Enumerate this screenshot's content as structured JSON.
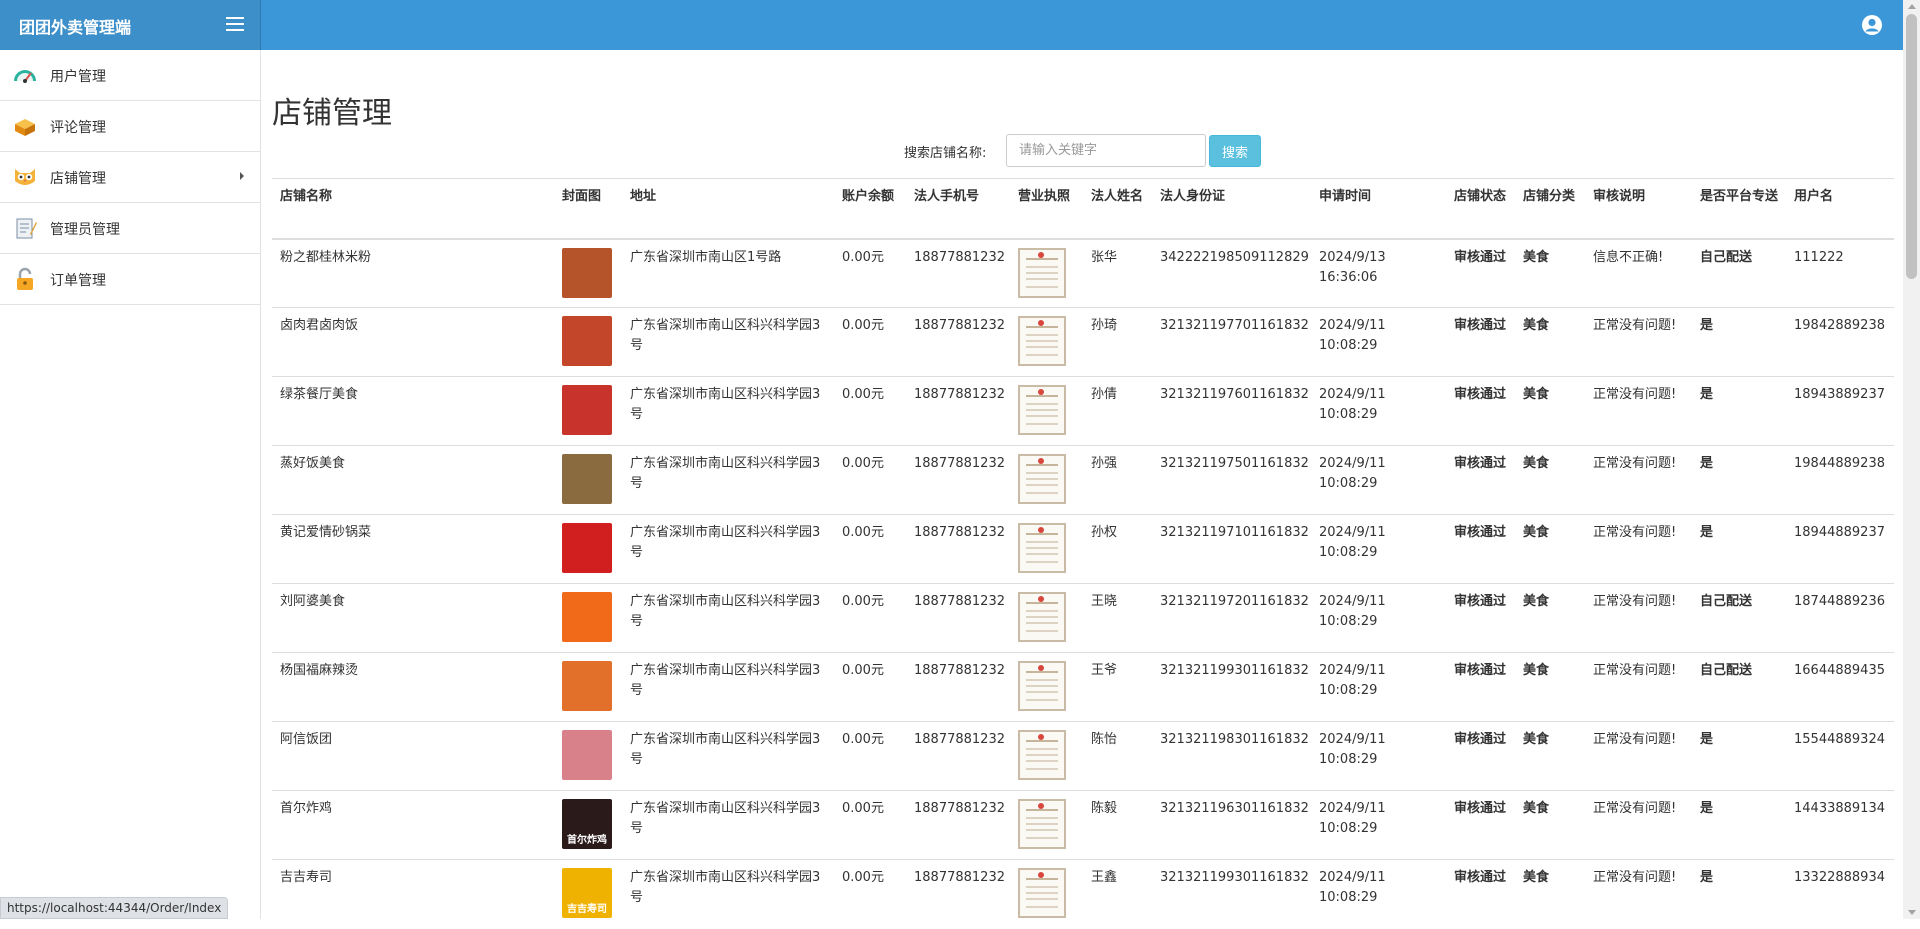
{
  "app": {
    "title": "团团外卖管理端"
  },
  "sidebar": {
    "items": [
      {
        "label": "用户管理",
        "icon": "dashboard-icon",
        "color": "#2bb3a0"
      },
      {
        "label": "评论管理",
        "icon": "bricks-icon",
        "color": "#f0a21b"
      },
      {
        "label": "店铺管理",
        "icon": "owl-icon",
        "color": "#f4b23a",
        "has_submenu": true
      },
      {
        "label": "管理员管理",
        "icon": "notepad-icon",
        "color": "#7a8fa6"
      },
      {
        "label": "订单管理",
        "icon": "padlock-icon",
        "color": "#f5a623"
      }
    ]
  },
  "page": {
    "title": "店铺管理"
  },
  "search": {
    "label": "搜索店铺名称:",
    "placeholder": "请输入关键字",
    "button": "搜索"
  },
  "table": {
    "headers": [
      "店铺名称",
      "封面图",
      "地址",
      "账户余额",
      "法人手机号",
      "营业执照",
      "法人姓名",
      "法人身份证",
      "申请时间",
      "店铺状态",
      "店铺分类",
      "审核说明",
      "是否平台专送",
      "用户名"
    ],
    "rows": [
      {
        "name": "粉之都桂林米粉",
        "cover_color": "#b5542b",
        "cover_text": "",
        "address": "广东省深圳市南山区1号路",
        "balance": "0.00元",
        "phone": "18877881232",
        "legal_name": "张华",
        "id_card": "342222198509112829",
        "apply_time": "2024/9/13 16:36:06",
        "status": "审核通过",
        "category": "美食",
        "note": "信息不正确!",
        "platform_delivery": "自己配送",
        "username": "111222"
      },
      {
        "name": "卤肉君卤肉饭",
        "cover_color": "#c4462a",
        "cover_text": "",
        "address": "广东省深圳市南山区科兴科学园3号",
        "balance": "0.00元",
        "phone": "18877881232",
        "legal_name": "孙琦",
        "id_card": "321321197701161832",
        "apply_time": "2024/9/11 10:08:29",
        "status": "审核通过",
        "category": "美食",
        "note": "正常没有问题!",
        "platform_delivery": "是",
        "username": "19842889238"
      },
      {
        "name": "绿茶餐厅美食",
        "cover_color": "#c8342c",
        "cover_text": "",
        "address": "广东省深圳市南山区科兴科学园3号",
        "balance": "0.00元",
        "phone": "18877881232",
        "legal_name": "孙倩",
        "id_card": "321321197601161832",
        "apply_time": "2024/9/11 10:08:29",
        "status": "审核通过",
        "category": "美食",
        "note": "正常没有问题!",
        "platform_delivery": "是",
        "username": "18943889237"
      },
      {
        "name": "蒸好饭美食",
        "cover_color": "#8a6a3f",
        "cover_text": "",
        "address": "广东省深圳市南山区科兴科学园3号",
        "balance": "0.00元",
        "phone": "18877881232",
        "legal_name": "孙强",
        "id_card": "321321197501161832",
        "apply_time": "2024/9/11 10:08:29",
        "status": "审核通过",
        "category": "美食",
        "note": "正常没有问题!",
        "platform_delivery": "是",
        "username": "19844889238"
      },
      {
        "name": "黄记爱情砂锅菜",
        "cover_color": "#d11f1f",
        "cover_text": "",
        "address": "广东省深圳市南山区科兴科学园3号",
        "balance": "0.00元",
        "phone": "18877881232",
        "legal_name": "孙权",
        "id_card": "321321197101161832",
        "apply_time": "2024/9/11 10:08:29",
        "status": "审核通过",
        "category": "美食",
        "note": "正常没有问题!",
        "platform_delivery": "是",
        "username": "18944889237"
      },
      {
        "name": "刘阿婆美食",
        "cover_color": "#f06a1a",
        "cover_text": "",
        "address": "广东省深圳市南山区科兴科学园3号",
        "balance": "0.00元",
        "phone": "18877881232",
        "legal_name": "王晓",
        "id_card": "321321197201161832",
        "apply_time": "2024/9/11 10:08:29",
        "status": "审核通过",
        "category": "美食",
        "note": "正常没有问题!",
        "platform_delivery": "自己配送",
        "username": "18744889236"
      },
      {
        "name": "杨国福麻辣烫",
        "cover_color": "#e2702a",
        "cover_text": "",
        "address": "广东省深圳市南山区科兴科学园3号",
        "balance": "0.00元",
        "phone": "18877881232",
        "legal_name": "王爷",
        "id_card": "321321199301161832",
        "apply_time": "2024/9/11 10:08:29",
        "status": "审核通过",
        "category": "美食",
        "note": "正常没有问题!",
        "platform_delivery": "自己配送",
        "username": "16644889435"
      },
      {
        "name": "阿信饭团",
        "cover_color": "#d9818a",
        "cover_text": "",
        "address": "广东省深圳市南山区科兴科学园3号",
        "balance": "0.00元",
        "phone": "18877881232",
        "legal_name": "陈怡",
        "id_card": "321321198301161832",
        "apply_time": "2024/9/11 10:08:29",
        "status": "审核通过",
        "category": "美食",
        "note": "正常没有问题!",
        "platform_delivery": "是",
        "username": "15544889324"
      },
      {
        "name": "首尔炸鸡",
        "cover_color": "#2a1a1a",
        "cover_text": "首尔炸鸡",
        "address": "广东省深圳市南山区科兴科学园3号",
        "balance": "0.00元",
        "phone": "18877881232",
        "legal_name": "陈毅",
        "id_card": "321321196301161832",
        "apply_time": "2024/9/11 10:08:29",
        "status": "审核通过",
        "category": "美食",
        "note": "正常没有问题!",
        "platform_delivery": "是",
        "username": "14433889134"
      },
      {
        "name": "吉吉寿司",
        "cover_color": "#f0b200",
        "cover_text": "吉吉寿司",
        "address": "广东省深圳市南山区科兴科学园3号",
        "balance": "0.00元",
        "phone": "18877881232",
        "legal_name": "王鑫",
        "id_card": "321321199301161832",
        "apply_time": "2024/9/11 10:08:29",
        "status": "审核通过",
        "category": "美食",
        "note": "正常没有问题!",
        "platform_delivery": "是",
        "username": "13322888934"
      }
    ]
  },
  "status_bar": {
    "url": "https://localhost:44344/Order/Index"
  },
  "colors": {
    "topbar": "#3c97d9",
    "brand": "#3d8fc9",
    "search_button": "#5bc0de"
  }
}
